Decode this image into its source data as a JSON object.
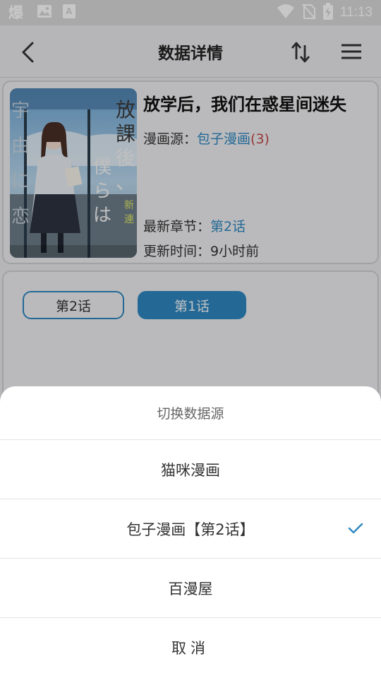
{
  "status_bar": {
    "time": "11:13",
    "icons": [
      "app-notification-icon",
      "image-icon",
      "font-icon",
      "wifi-icon",
      "no-sim-icon",
      "battery-charging-icon"
    ]
  },
  "toolbar": {
    "title": "数据详情",
    "icons": [
      "back-arrow-icon",
      "sort-swap-icon",
      "menu-icon"
    ]
  },
  "detail": {
    "title": "放学后，我们在惑星间迷失",
    "source_label": "漫画源：",
    "source_name": "包子漫画",
    "source_count": "(3)",
    "latest_label": "最新章节：",
    "latest_value": "第2话",
    "updated_label": "更新时间：",
    "updated_value": "9小时前"
  },
  "chapters": [
    {
      "label": "第2话",
      "style": "outline"
    },
    {
      "label": "第1话",
      "style": "filled"
    }
  ],
  "sheet": {
    "title": "切换数据源",
    "options": [
      {
        "label": "猫咪漫画",
        "selected": false
      },
      {
        "label": "包子漫画【第2话】",
        "selected": true
      },
      {
        "label": "百漫屋",
        "selected": false
      }
    ],
    "cancel": "取消"
  },
  "colors": {
    "accent": "#2f87c0",
    "count_red": "#c24747",
    "sheet_bg": "#ffffff",
    "page_bg": "#e9eaec"
  }
}
